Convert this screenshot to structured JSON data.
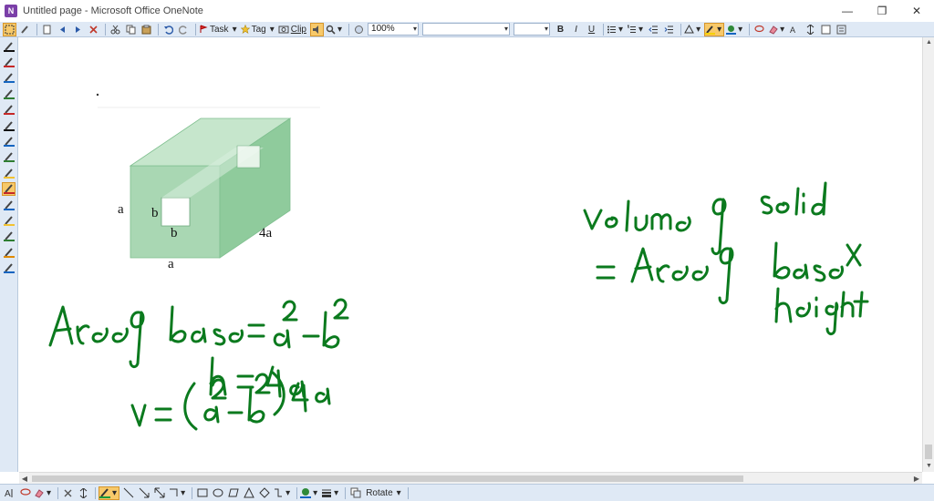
{
  "window": {
    "title": "Untitled page - Microsoft Office OneNote",
    "app_icon": "N",
    "minimize": "—",
    "restore": "❐",
    "close": "✕"
  },
  "toolbar": {
    "task_label": "Task",
    "tag_label": "Tag",
    "clip_label": "Clip",
    "zoom_value": "100%",
    "font_value": "",
    "size_value": "",
    "bold": "B",
    "italic": "I",
    "underline": "U"
  },
  "drawbar": {
    "rotate_label": "Rotate"
  },
  "figure_labels": {
    "a_left": "a",
    "b_left": "b",
    "b_bottom": "b",
    "a_bottom": "a",
    "four_a": "4a"
  },
  "handwriting": {
    "line1": "Area of base = a² − b²",
    "line2": "h = 4a",
    "line3": "V = (a² − b²) 4a",
    "right1": "Volume of solid",
    "right2": "= Area of base ×",
    "right3": "height"
  },
  "colors": {
    "ink_green": "#0b7a1e",
    "prism_face": "#a9d7b3",
    "prism_top": "#c6e6cc",
    "prism_side": "#8fcb9c",
    "toolbar_bg": "#dfe9f5"
  }
}
